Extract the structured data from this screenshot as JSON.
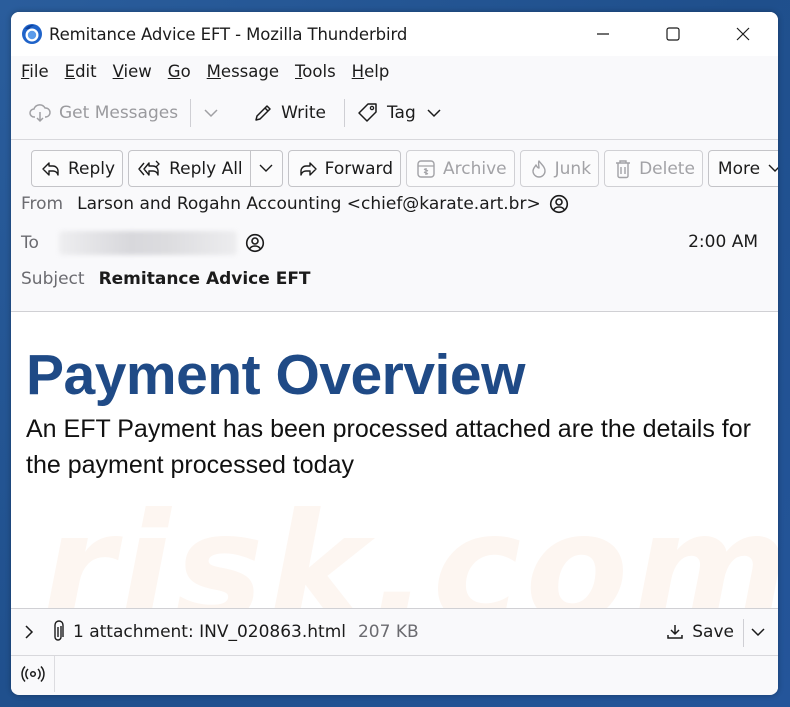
{
  "window": {
    "title": "Remitance Advice EFT - Mozilla Thunderbird",
    "app_icon": "thunderbird-logo-icon",
    "controls": [
      "minimize-icon",
      "maximize-icon",
      "close-icon"
    ]
  },
  "menubar": {
    "items": [
      {
        "label": "File",
        "accel": "F",
        "rest": "ile"
      },
      {
        "label": "Edit",
        "accel": "E",
        "rest": "dit"
      },
      {
        "label": "View",
        "accel": "V",
        "rest": "iew"
      },
      {
        "label": "Go",
        "accel": "G",
        "rest": "o"
      },
      {
        "label": "Message",
        "accel": "M",
        "rest": "essage"
      },
      {
        "label": "Tools",
        "accel": "T",
        "rest": "ools"
      },
      {
        "label": "Help",
        "accel": "H",
        "rest": "elp"
      }
    ]
  },
  "toolbar": {
    "get_messages": "Get Messages",
    "write": "Write",
    "tag": "Tag"
  },
  "header_toolbar": {
    "reply": "Reply",
    "reply_all": "Reply All",
    "forward": "Forward",
    "archive": "Archive",
    "junk": "Junk",
    "delete": "Delete",
    "more": "More"
  },
  "message": {
    "from_label": "From",
    "from_value": "Larson and Rogahn Accounting <chief@karate.art.br>",
    "to_label": "To",
    "to_value_redacted": true,
    "time": "2:00 AM",
    "subject_label": "Subject",
    "subject_value": "Remitance Advice EFT"
  },
  "body": {
    "title": "Payment Overview",
    "text": "An EFT Payment has been processed attached are the details for the payment processed today",
    "title_color": "#1f4a86",
    "watermark": "risk.com"
  },
  "attachment": {
    "label": "1 attachment: INV_020863.html",
    "size": "207 KB",
    "save": "Save"
  },
  "status": {
    "icon": "broadcast-icon"
  }
}
